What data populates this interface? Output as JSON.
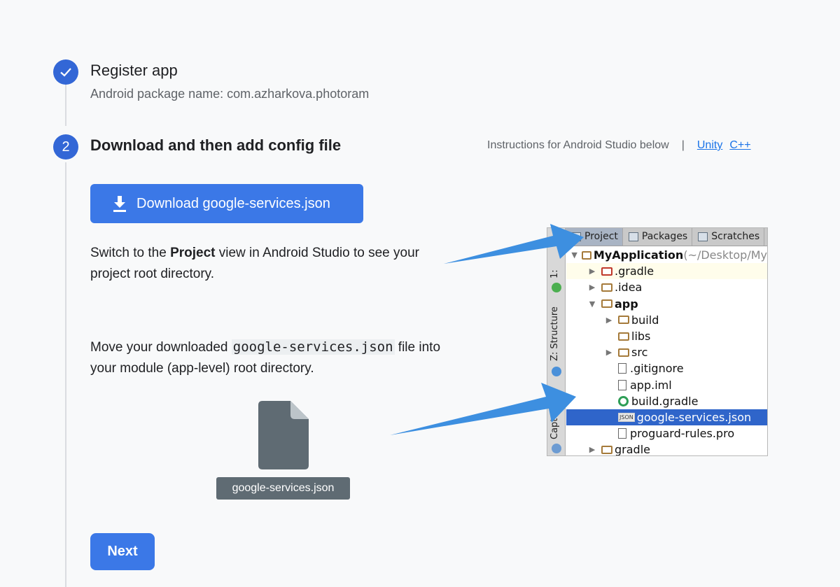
{
  "step1": {
    "title": "Register app",
    "subtitle": "Android package name: com.azharkova.photoram",
    "status": "complete"
  },
  "step2": {
    "number": "2",
    "title": "Download and then add config file",
    "instructions_text": "Instructions for Android Studio below",
    "separator": "|",
    "links": [
      "Unity",
      "C++"
    ],
    "download_button": "Download google-services.json",
    "para1_prefix": "Switch to the ",
    "para1_bold": "Project",
    "para1_suffix": " view in Android Studio to see your project root directory.",
    "para2_prefix": "Move your downloaded ",
    "para2_code": "google-services.json",
    "para2_suffix": " file into your module (app-level) root directory.",
    "file_label": "google-services.json",
    "next_button": "Next"
  },
  "ide": {
    "tabs": [
      "Project",
      "Packages",
      "Scratches"
    ],
    "side_labels": [
      "1:",
      "Z: Structure",
      "Captur"
    ],
    "tree": [
      {
        "indent": 0,
        "arrow": "▼",
        "icon": "module-folder",
        "name": "MyApplication",
        "suffix": " (~/Desktop/My",
        "bold": true
      },
      {
        "indent": 1,
        "arrow": "▶",
        "icon": "folder-red",
        "name": ".gradle",
        "highlight": true
      },
      {
        "indent": 1,
        "arrow": "▶",
        "icon": "folder",
        "name": ".idea"
      },
      {
        "indent": 1,
        "arrow": "▼",
        "icon": "module-folder",
        "name": "app",
        "bold": true
      },
      {
        "indent": 2,
        "arrow": "▶",
        "icon": "folder",
        "name": "build"
      },
      {
        "indent": 2,
        "arrow": "",
        "icon": "folder",
        "name": "libs"
      },
      {
        "indent": 2,
        "arrow": "▶",
        "icon": "folder",
        "name": "src"
      },
      {
        "indent": 2,
        "arrow": "",
        "icon": "file",
        "name": ".gitignore"
      },
      {
        "indent": 2,
        "arrow": "",
        "icon": "file",
        "name": "app.iml"
      },
      {
        "indent": 2,
        "arrow": "",
        "icon": "gradle",
        "name": "build.gradle"
      },
      {
        "indent": 2,
        "arrow": "",
        "icon": "json",
        "name": "google-services.json",
        "selected": true
      },
      {
        "indent": 2,
        "arrow": "",
        "icon": "file",
        "name": "proguard-rules.pro"
      },
      {
        "indent": 1,
        "arrow": "▶",
        "icon": "folder",
        "name": "gradle"
      }
    ]
  },
  "colors": {
    "primary": "#3b78e7",
    "step_circle": "#3367d6",
    "link": "#1a73e8",
    "arrow": "#3d8fe0"
  }
}
